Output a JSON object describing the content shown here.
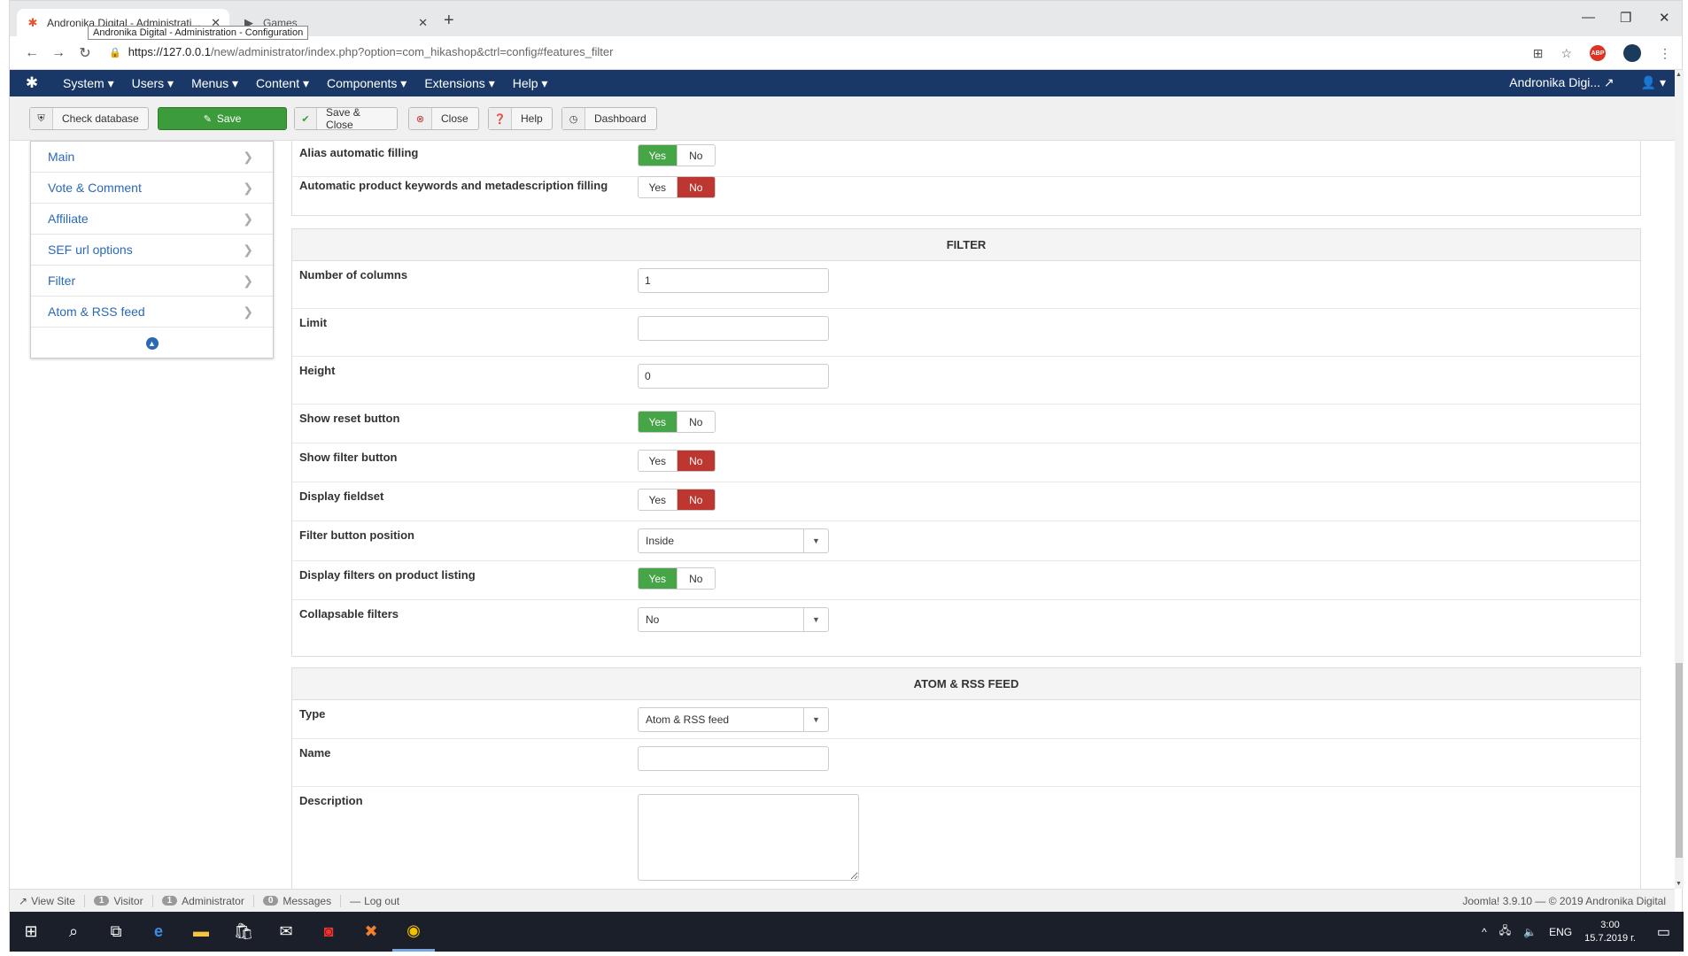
{
  "browser": {
    "tabs": [
      {
        "title": "Andronika Digital - Administrati...",
        "active": true
      },
      {
        "title": "Games",
        "active": false
      }
    ],
    "tooltip": "Andronika Digital - Administration - Configuration",
    "url_host": "https://127.0.0.1",
    "url_path": "/new/administrator/index.php?option=com_hikashop&ctrl=config#features_filter",
    "abp_label": "ABP"
  },
  "joomla_nav": {
    "menus": [
      "System",
      "Users",
      "Menus",
      "Content",
      "Components",
      "Extensions",
      "Help"
    ],
    "site_name": "Andronika Digi..."
  },
  "toolbar": {
    "check_database": "Check database",
    "save": "Save",
    "save_close": "Save & Close",
    "close": "Close",
    "help": "Help",
    "dashboard": "Dashboard"
  },
  "sidebar": {
    "items": [
      "Main",
      "Vote & Comment",
      "Affiliate",
      "SEF url options",
      "Filter",
      "Atom & RSS feed"
    ]
  },
  "toggle_labels": {
    "yes": "Yes",
    "no": "No"
  },
  "top_panel": {
    "rows": [
      {
        "label": "Alias automatic filling",
        "value": "Yes"
      },
      {
        "label": "Automatic product keywords and metadescription filling",
        "value": "No"
      }
    ]
  },
  "filter_panel": {
    "title": "FILTER",
    "number_of_columns": {
      "label": "Number of columns",
      "value": "1"
    },
    "limit": {
      "label": "Limit",
      "value": ""
    },
    "height": {
      "label": "Height",
      "value": "0"
    },
    "show_reset_button": {
      "label": "Show reset button",
      "value": "Yes"
    },
    "show_filter_button": {
      "label": "Show filter button",
      "value": "No"
    },
    "display_fieldset": {
      "label": "Display fieldset",
      "value": "No"
    },
    "filter_button_position": {
      "label": "Filter button position",
      "value": "Inside"
    },
    "display_filters_listing": {
      "label": "Display filters on product listing",
      "value": "Yes"
    },
    "collapsable_filters": {
      "label": "Collapsable filters",
      "value": "No"
    }
  },
  "rss_panel": {
    "title": "ATOM & RSS FEED",
    "type": {
      "label": "Type",
      "value": "Atom & RSS feed"
    },
    "name": {
      "label": "Name",
      "value": ""
    },
    "description": {
      "label": "Description",
      "value": ""
    }
  },
  "status_bar": {
    "view_site": "View Site",
    "visitor_count": "1",
    "visitor_label": "Visitor",
    "admin_count": "1",
    "admin_label": "Administrator",
    "messages_count": "0",
    "messages_label": "Messages",
    "logout": "Log out",
    "footer": "Joomla! 3.9.10 — © 2019 Andronika Digital"
  },
  "taskbar": {
    "lang": "ENG",
    "time": "3:00",
    "date": "15.7.2019 г."
  },
  "colors": {
    "nav_bg": "#1a3867",
    "yes_active": "#46a546",
    "no_active": "#bd362f",
    "link": "#2a69b8"
  }
}
